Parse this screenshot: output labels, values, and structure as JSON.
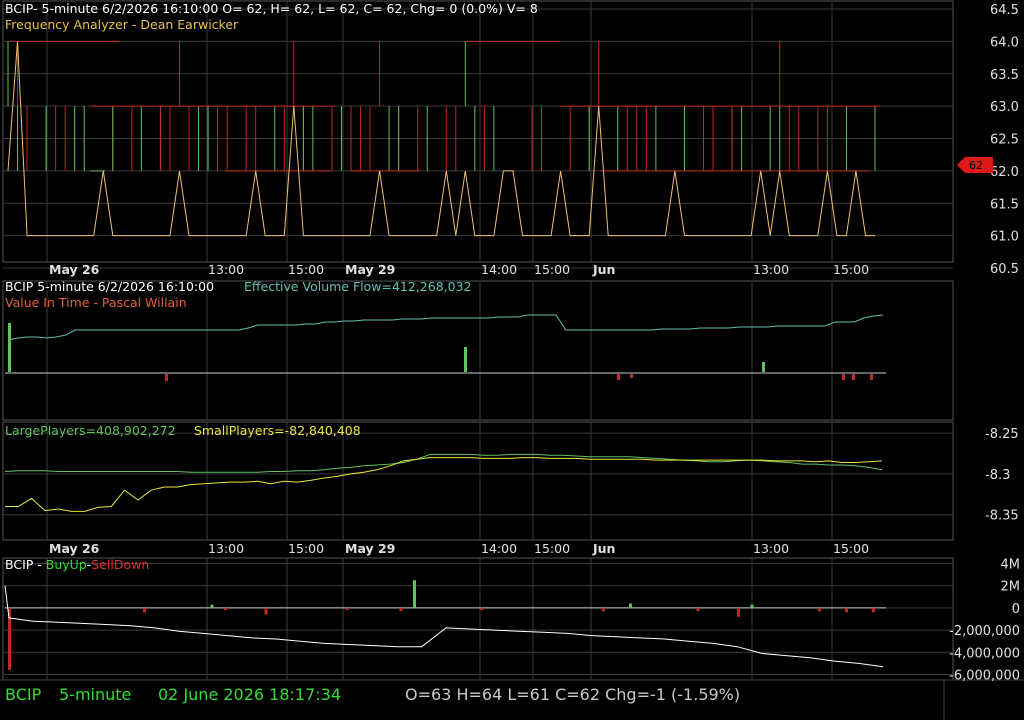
{
  "theme": {
    "green": "#5ec25e",
    "red": "#c22727",
    "yellow": "#e8e83a",
    "orange": "#f0c070",
    "cyan": "#60c0b0",
    "white": "#ffffff",
    "grid": "#3a3a3a",
    "axis_text": "#e0e0e0",
    "status_green": "#33dd33",
    "status_grey": "#c8c8c8"
  },
  "panel1": {
    "header_line1": "BCIP- 5-minute 6/2/2026 16:10:00 O= 62, H= 62, L= 62, C= 62, Chg= 0 (0.0%) V= 8",
    "header_line2": "Frequency Analyzer - Dean Earwicker",
    "price_marker": "62"
  },
  "panel2": {
    "header_a": "BCIP 5-minute  6/2/2026 16:10:00",
    "header_b": "Effective Volume Flow=412,268,032",
    "header_line2": "Value In Time - Pascal Willain"
  },
  "panel3": {
    "header_a": "LargePlayers=408,902,272",
    "header_b": "SmallPlayers=-82,840,408"
  },
  "panel4": {
    "header_a": "BCIP - ",
    "header_b": "BuyUp",
    "header_c": "-",
    "header_d": "SellDown"
  },
  "status": {
    "symbol": "BCIP",
    "interval": "5-minute",
    "datetime": "02 June 2026 18:17:34",
    "ohlc": "O=63  H=64  L=61  C=62  Chg=-1 (-1.59%)"
  },
  "chart_data": [
    {
      "type": "line",
      "name": "price-frequency-panel",
      "x_ticks": [
        "May 26",
        "13:00",
        "15:00",
        "May 29",
        "14:00",
        "15:00",
        "Jun",
        "13:00",
        "15:00"
      ],
      "y_ticks": [
        "64.5",
        "64.0",
        "63.5",
        "63.0",
        "62.5",
        "62.0",
        "61.5",
        "61.0",
        "60.5"
      ],
      "ylim": [
        60.5,
        64.5
      ],
      "price_levels": [
        61,
        62,
        63,
        64
      ],
      "series": [
        {
          "values": [
            62,
            64,
            61,
            61,
            61,
            61,
            61,
            61,
            61,
            61,
            62,
            61,
            61,
            61,
            61,
            61,
            61,
            61,
            62,
            61,
            61,
            61,
            61,
            61,
            61,
            61,
            62,
            61,
            61,
            61,
            63,
            61,
            61,
            61,
            61,
            61,
            61,
            61,
            61,
            62,
            61,
            61,
            61,
            61,
            61,
            61,
            62,
            61,
            62,
            61,
            61,
            61,
            62,
            62,
            61,
            61,
            61,
            61,
            62,
            61,
            61,
            61,
            63,
            61,
            61,
            61,
            61,
            61,
            61,
            61,
            62,
            61,
            61,
            61,
            61,
            61,
            61,
            61,
            61,
            62,
            61,
            62,
            61,
            61,
            61,
            61,
            62,
            61,
            61,
            62,
            61,
            61
          ]
        }
      ]
    },
    {
      "type": "line",
      "name": "effective-volume-flow-panel",
      "x_ticks": [],
      "y_ticks": [],
      "series": [
        {
          "values": [
            340,
            338,
            337,
            337,
            338,
            337,
            335,
            330,
            330,
            330,
            330,
            330,
            330,
            330,
            330,
            330,
            330,
            330,
            330,
            330,
            330,
            330,
            330,
            330,
            330,
            328,
            325,
            325,
            325,
            325,
            325,
            324,
            324,
            322,
            322,
            321,
            321,
            320,
            320,
            320,
            320,
            319,
            319,
            319,
            318,
            318,
            318,
            318,
            318,
            318,
            318,
            317,
            317,
            317,
            315,
            315,
            315,
            315,
            330,
            330,
            330,
            330,
            330,
            330,
            330,
            330,
            330,
            330,
            329,
            329,
            329,
            329,
            328,
            328,
            328,
            328,
            327,
            327,
            327,
            327,
            326,
            326,
            326,
            326,
            326,
            326,
            322,
            322,
            322,
            318,
            316,
            315
          ]
        }
      ]
    },
    {
      "type": "line",
      "name": "large-small-players-panel",
      "y_ticks": [
        "-8.25",
        "-8.3",
        "-8.35"
      ],
      "ylim": [
        -8.37,
        -8.24
      ],
      "series": [
        {
          "values": [
            -8.297,
            -8.296,
            -8.296,
            -8.296,
            -8.297,
            -8.297,
            -8.297,
            -8.297,
            -8.297,
            -8.297,
            -8.297,
            -8.297,
            -8.297,
            -8.297,
            -8.298,
            -8.298,
            -8.298,
            -8.298,
            -8.298,
            -8.298,
            -8.297,
            -8.297,
            -8.296,
            -8.296,
            -8.295,
            -8.293,
            -8.292,
            -8.29,
            -8.289,
            -8.288,
            -8.286,
            -8.282,
            -8.276,
            -8.276,
            -8.276,
            -8.276,
            -8.277,
            -8.277,
            -8.276,
            -8.276,
            -8.276,
            -8.277,
            -8.277,
            -8.278,
            -8.279,
            -8.279,
            -8.279,
            -8.279,
            -8.28,
            -8.281,
            -8.282,
            -8.283,
            -8.284,
            -8.285,
            -8.285,
            -8.284,
            -8.283,
            -8.284,
            -8.285,
            -8.286,
            -8.288,
            -8.288,
            -8.289,
            -8.289,
            -8.29,
            -8.292,
            -8.295
          ]
        },
        {
          "values": [
            -8.34,
            -8.34,
            -8.33,
            -8.345,
            -8.343,
            -8.346,
            -8.346,
            -8.341,
            -8.34,
            -8.32,
            -8.332,
            -8.32,
            -8.316,
            -8.316,
            -8.313,
            -8.312,
            -8.311,
            -8.31,
            -8.31,
            -8.309,
            -8.312,
            -8.309,
            -8.31,
            -8.308,
            -8.305,
            -8.303,
            -8.3,
            -8.298,
            -8.295,
            -8.29,
            -8.284,
            -8.282,
            -8.28,
            -8.28,
            -8.28,
            -8.28,
            -8.281,
            -8.281,
            -8.281,
            -8.28,
            -8.28,
            -8.281,
            -8.281,
            -8.281,
            -8.282,
            -8.282,
            -8.282,
            -8.282,
            -8.282,
            -8.283,
            -8.283,
            -8.283,
            -8.283,
            -8.283,
            -8.283,
            -8.283,
            -8.283,
            -8.283,
            -8.284,
            -8.284,
            -8.284,
            -8.285,
            -8.284,
            -8.286,
            -8.286,
            -8.285,
            -8.284
          ]
        }
      ]
    },
    {
      "type": "bar",
      "name": "buyup-selldown-panel",
      "x_ticks": [
        "May 26",
        "13:00",
        "15:00",
        "May 29",
        "14:00",
        "15:00",
        "Jun",
        "13:00",
        "15:00"
      ],
      "y_ticks": [
        "4M",
        "2M",
        "0",
        "-2,000,000",
        "-4,000,000",
        "-6,000,000"
      ],
      "ylim": [
        -6500000,
        4500000
      ],
      "series": [
        {
          "values": [
            -5600000,
            0,
            0,
            0,
            0,
            0,
            0,
            0,
            0,
            0,
            -400000,
            0,
            0,
            0,
            0,
            300000,
            -200000,
            0,
            0,
            -600000,
            0,
            0,
            0,
            0,
            0,
            -200000,
            0,
            0,
            0,
            -300000,
            2500000,
            0,
            0,
            0,
            0,
            -200000,
            0,
            0,
            0,
            0,
            0,
            0,
            0,
            0,
            -300000,
            0,
            400000,
            0,
            0,
            0,
            0,
            -300000,
            0,
            0,
            -800000,
            300000,
            0,
            0,
            0,
            0,
            -300000,
            0,
            -400000,
            0,
            -400000
          ]
        },
        {
          "values": [
            -900000,
            -1200000,
            -1300000,
            -1400000,
            -1500000,
            -1600000,
            -1800000,
            -2100000,
            -2300000,
            -2500000,
            -2700000,
            -2800000,
            -3000000,
            -3200000,
            -3300000,
            -3400000,
            -3500000,
            -3500000,
            -1800000,
            -1900000,
            -2000000,
            -2100000,
            -2200000,
            -2300000,
            -2500000,
            -2600000,
            -2700000,
            -2800000,
            -3000000,
            -3200000,
            -3500000,
            -4100000,
            -4300000,
            -4500000,
            -4800000,
            -5000000,
            -5300000
          ]
        }
      ]
    }
  ]
}
